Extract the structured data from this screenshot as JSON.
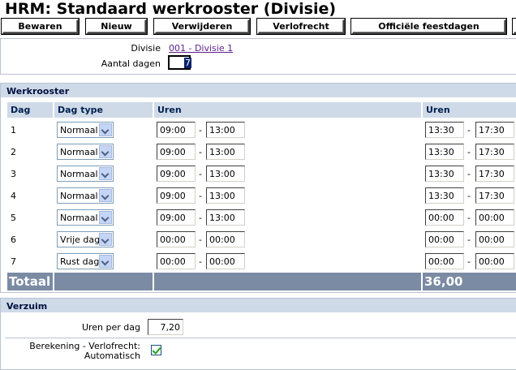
{
  "title": "HRM: Standaard werkrooster (Divisie)",
  "toolbar": {
    "buttons": [
      {
        "id": "bewaren",
        "label": "Bewaren"
      },
      {
        "id": "nieuw",
        "label": "Nieuw"
      },
      {
        "id": "verwijderen",
        "label": "Verwijderen"
      },
      {
        "id": "verlofrecht",
        "label": "Verlofrecht"
      },
      {
        "id": "feestdagen",
        "label": "Officiële feestdagen"
      }
    ]
  },
  "header": {
    "divisie_label": "Divisie",
    "divisie_value": "001 - Divisie 1",
    "dagen_label": "Aantal dagen",
    "dagen_value": "7"
  },
  "werkrooster": {
    "title": "Werkrooster",
    "columns": {
      "dag": "Dag",
      "dagtype": "Dag type",
      "uren1": "Uren",
      "uren2": "Uren"
    },
    "rows": [
      {
        "dag": "1",
        "type": "Normaal",
        "a_from": "09:00",
        "a_to": "13:00",
        "b_from": "13:30",
        "b_to": "17:30"
      },
      {
        "dag": "2",
        "type": "Normaal",
        "a_from": "09:00",
        "a_to": "13:00",
        "b_from": "13:30",
        "b_to": "17:30"
      },
      {
        "dag": "3",
        "type": "Normaal",
        "a_from": "09:00",
        "a_to": "13:00",
        "b_from": "13:30",
        "b_to": "17:30"
      },
      {
        "dag": "4",
        "type": "Normaal",
        "a_from": "09:00",
        "a_to": "13:00",
        "b_from": "13:30",
        "b_to": "17:30"
      },
      {
        "dag": "5",
        "type": "Normaal",
        "a_from": "09:00",
        "a_to": "13:00",
        "b_from": "00:00",
        "b_to": "00:00"
      },
      {
        "dag": "6",
        "type": "Vrije dag",
        "a_from": "00:00",
        "a_to": "00:00",
        "b_from": "00:00",
        "b_to": "00:00"
      },
      {
        "dag": "7",
        "type": "Rust dag",
        "a_from": "00:00",
        "a_to": "00:00",
        "b_from": "00:00",
        "b_to": "00:00"
      }
    ],
    "separator": "-",
    "total_label": "Totaal",
    "total_value": "36,00"
  },
  "verzuim": {
    "title": "Verzuim",
    "uren_label": "Uren per dag",
    "uren_value": "7,20",
    "berekening_label_1": "Berekening - Verlofrecht:",
    "berekening_label_2": "Automatisch",
    "berekening_checked": true
  }
}
